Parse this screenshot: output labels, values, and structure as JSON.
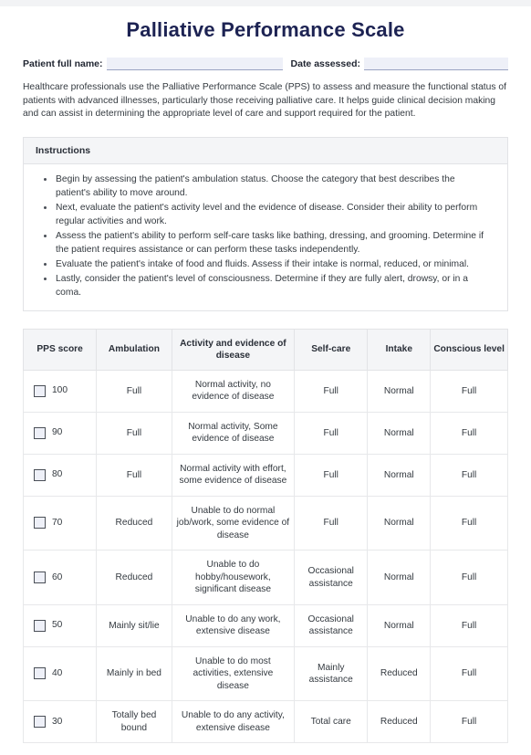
{
  "document": {
    "title": "Palliative Performance Scale",
    "intro": "Healthcare professionals use the Palliative Performance Scale (PPS) to assess and measure the functional status of patients with advanced illnesses, particularly those receiving palliative care. It helps guide clinical decision making and can assist in determining the appropriate level of care and support required for the patient."
  },
  "fields": {
    "patient_name_label": "Patient full name:",
    "patient_name_value": "",
    "date_assessed_label": "Date assessed:",
    "date_assessed_value": ""
  },
  "instructions": {
    "heading": "Instructions",
    "items": [
      "Begin by assessing the patient's ambulation status. Choose the category that best describes the patient's ability to move around.",
      "Next, evaluate the patient's activity level and the evidence of disease. Consider their ability to perform regular activities and work.",
      "Assess the patient's ability to perform self-care tasks like bathing, dressing, and grooming. Determine if the patient requires assistance or can perform these tasks independently.",
      "Evaluate the patient's intake of food and fluids. Assess if their intake is normal, reduced, or minimal.",
      "Lastly, consider the patient's level of consciousness. Determine if they are fully alert, drowsy, or in a coma."
    ]
  },
  "table": {
    "columns": [
      "PPS score",
      "Ambulation",
      "Activity and evidence of disease",
      "Self-care",
      "Intake",
      "Conscious level"
    ],
    "rows": [
      {
        "score": "100",
        "checked": false,
        "ambulation": "Full",
        "activity": "Normal activity, no evidence of disease",
        "self_care": "Full",
        "intake": "Normal",
        "conscious": "Full"
      },
      {
        "score": "90",
        "checked": false,
        "ambulation": "Full",
        "activity": "Normal activity, Some evidence of disease",
        "self_care": "Full",
        "intake": "Normal",
        "conscious": "Full"
      },
      {
        "score": "80",
        "checked": false,
        "ambulation": "Full",
        "activity": "Normal activity with effort, some evidence of disease",
        "self_care": "Full",
        "intake": "Normal",
        "conscious": "Full"
      },
      {
        "score": "70",
        "checked": false,
        "ambulation": "Reduced",
        "activity": "Unable to do normal job/work, some evidence of disease",
        "self_care": "Full",
        "intake": "Normal",
        "conscious": "Full"
      },
      {
        "score": "60",
        "checked": false,
        "ambulation": "Reduced",
        "activity": "Unable to do hobby/housework, significant disease",
        "self_care": "Occasional assistance",
        "intake": "Normal",
        "conscious": "Full"
      },
      {
        "score": "50",
        "checked": false,
        "ambulation": "Mainly sit/lie",
        "activity": "Unable to do any work, extensive disease",
        "self_care": "Occasional assistance",
        "intake": "Normal",
        "conscious": "Full"
      },
      {
        "score": "40",
        "checked": false,
        "ambulation": "Mainly in bed",
        "activity": "Unable to do most activities, extensive disease",
        "self_care": "Mainly assistance",
        "intake": "Reduced",
        "conscious": "Full"
      },
      {
        "score": "30",
        "checked": false,
        "ambulation": "Totally bed bound",
        "activity": "Unable to do any activity, extensive disease",
        "self_care": "Total care",
        "intake": "Reduced",
        "conscious": "Full"
      }
    ]
  },
  "colors": {
    "title": "#1d2353",
    "field_fill": "#eef0f8",
    "panel_header_bg": "#f4f5f7",
    "border": "#e2e3e6"
  }
}
